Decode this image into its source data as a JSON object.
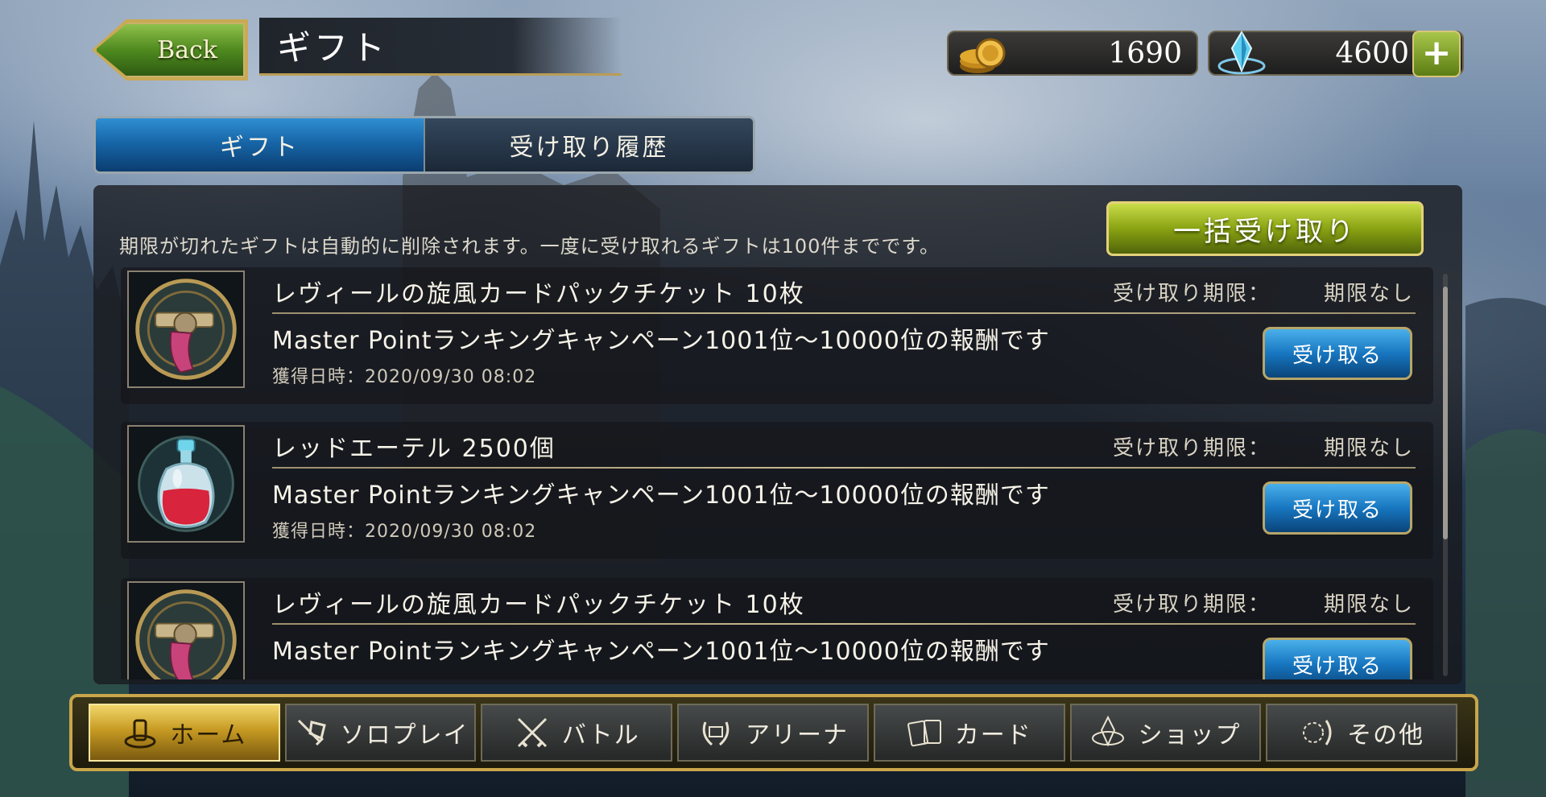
{
  "header": {
    "back_label": "Back",
    "title": "ギフト",
    "coins": "1690",
    "crystals": "4600",
    "plus_label": "+"
  },
  "tabs": [
    {
      "label": "ギフト",
      "active": true
    },
    {
      "label": "受け取り履歴",
      "active": false
    }
  ],
  "notice": "期限が切れたギフトは自動的に削除されます。一度に受け取れるギフトは100件までです。",
  "bulk_receive_label": "一括受け取り",
  "gifts": [
    {
      "name": "レヴィールの旋風カードパックチケット 10枚",
      "deadline_label": "受け取り期限：",
      "deadline_value": "期限なし",
      "description": "Master Pointランキングキャンペーン1001位〜10000位の報酬です",
      "date": "獲得日時：2020/09/30 08:02",
      "button": "受け取る",
      "icon": "revolver-ticket-icon"
    },
    {
      "name": "レッドエーテル 2500個",
      "deadline_label": "受け取り期限：",
      "deadline_value": "期限なし",
      "description": "Master Pointランキングキャンペーン1001位〜10000位の報酬です",
      "date": "獲得日時：2020/09/30 08:02",
      "button": "受け取る",
      "icon": "red-ether-potion-icon"
    },
    {
      "name": "レヴィールの旋風カードパックチケット 10枚",
      "deadline_label": "受け取り期限：",
      "deadline_value": "期限なし",
      "description": "Master Pointランキングキャンペーン1001位〜10000位の報酬です",
      "date": "",
      "button": "受け取る",
      "icon": "revolver-ticket-icon"
    }
  ],
  "nav": [
    {
      "label": "ホーム",
      "icon": "home-icon",
      "active": true
    },
    {
      "label": "ソロプレイ",
      "icon": "solo-play-icon",
      "active": false
    },
    {
      "label": "バトル",
      "icon": "crossed-swords-icon",
      "active": false
    },
    {
      "label": "アリーナ",
      "icon": "arena-laurel-icon",
      "active": false
    },
    {
      "label": "カード",
      "icon": "cards-icon",
      "active": false
    },
    {
      "label": "ショップ",
      "icon": "shop-crystal-icon",
      "active": false
    },
    {
      "label": "その他",
      "icon": "other-icon",
      "active": false
    }
  ],
  "colors": {
    "accent_blue": "#1766a8",
    "accent_green": "#8aa312",
    "gold_frame": "#c9a64a"
  }
}
